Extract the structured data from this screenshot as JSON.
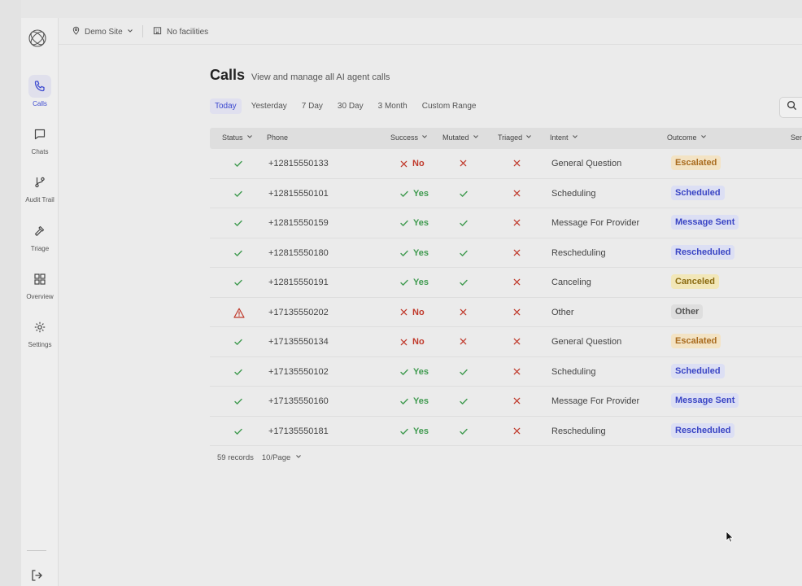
{
  "nav": {
    "items": [
      {
        "label": "Calls",
        "icon": "phone-icon",
        "active": true
      },
      {
        "label": "Chats",
        "icon": "chat-icon",
        "active": false
      },
      {
        "label": "Audit Trail",
        "icon": "branch-icon",
        "active": false
      },
      {
        "label": "Triage",
        "icon": "hammer-icon",
        "active": false
      },
      {
        "label": "Overview",
        "icon": "grid-icon",
        "active": false
      },
      {
        "label": "Settings",
        "icon": "gear-icon",
        "active": false
      }
    ]
  },
  "topbar": {
    "site": "Demo Site",
    "facilities": "No facilities"
  },
  "page": {
    "title": "Calls",
    "subtitle": "View and manage all AI agent calls"
  },
  "tabs": [
    "Today",
    "Yesterday",
    "7 Day",
    "30 Day",
    "3 Month",
    "Custom Range"
  ],
  "table": {
    "columns": [
      "Status",
      "Phone",
      "Success",
      "Mutated",
      "Triaged",
      "Intent",
      "Outcome",
      "Sen"
    ],
    "rows": [
      {
        "status": "ok",
        "phone": "+12815550133",
        "success": "No",
        "mutated": false,
        "triaged": false,
        "intent": "General Question",
        "outcome": "Escalated"
      },
      {
        "status": "ok",
        "phone": "+12815550101",
        "success": "Yes",
        "mutated": true,
        "triaged": false,
        "intent": "Scheduling",
        "outcome": "Scheduled"
      },
      {
        "status": "ok",
        "phone": "+12815550159",
        "success": "Yes",
        "mutated": true,
        "triaged": false,
        "intent": "Message For Provider",
        "outcome": "Message Sent"
      },
      {
        "status": "ok",
        "phone": "+12815550180",
        "success": "Yes",
        "mutated": true,
        "triaged": false,
        "intent": "Rescheduling",
        "outcome": "Rescheduled"
      },
      {
        "status": "ok",
        "phone": "+12815550191",
        "success": "Yes",
        "mutated": true,
        "triaged": false,
        "intent": "Canceling",
        "outcome": "Canceled"
      },
      {
        "status": "warn",
        "phone": "+17135550202",
        "success": "No",
        "mutated": false,
        "triaged": false,
        "intent": "Other",
        "outcome": "Other"
      },
      {
        "status": "ok",
        "phone": "+17135550134",
        "success": "No",
        "mutated": false,
        "triaged": false,
        "intent": "General Question",
        "outcome": "Escalated"
      },
      {
        "status": "ok",
        "phone": "+17135550102",
        "success": "Yes",
        "mutated": true,
        "triaged": false,
        "intent": "Scheduling",
        "outcome": "Scheduled"
      },
      {
        "status": "ok",
        "phone": "+17135550160",
        "success": "Yes",
        "mutated": true,
        "triaged": false,
        "intent": "Message For Provider",
        "outcome": "Message Sent"
      },
      {
        "status": "ok",
        "phone": "+17135550181",
        "success": "Yes",
        "mutated": true,
        "triaged": false,
        "intent": "Rescheduling",
        "outcome": "Rescheduled"
      }
    ]
  },
  "footer": {
    "records": "59 records",
    "per_page": "10/Page"
  },
  "colors": {
    "accent": "#3d4ad0",
    "success_green": "#3f9a4f",
    "error_red": "#c0392b",
    "warn_red": "#c0392b",
    "escalated_bg": "#f3e3c4",
    "escalated_fg": "#a86a1d",
    "blue_bg": "#dcdff4",
    "blue_fg": "#3a45c4",
    "canceled_bg": "#f2e7b8",
    "canceled_fg": "#8a6a10",
    "other_bg": "#dedede",
    "other_fg": "#555555"
  }
}
